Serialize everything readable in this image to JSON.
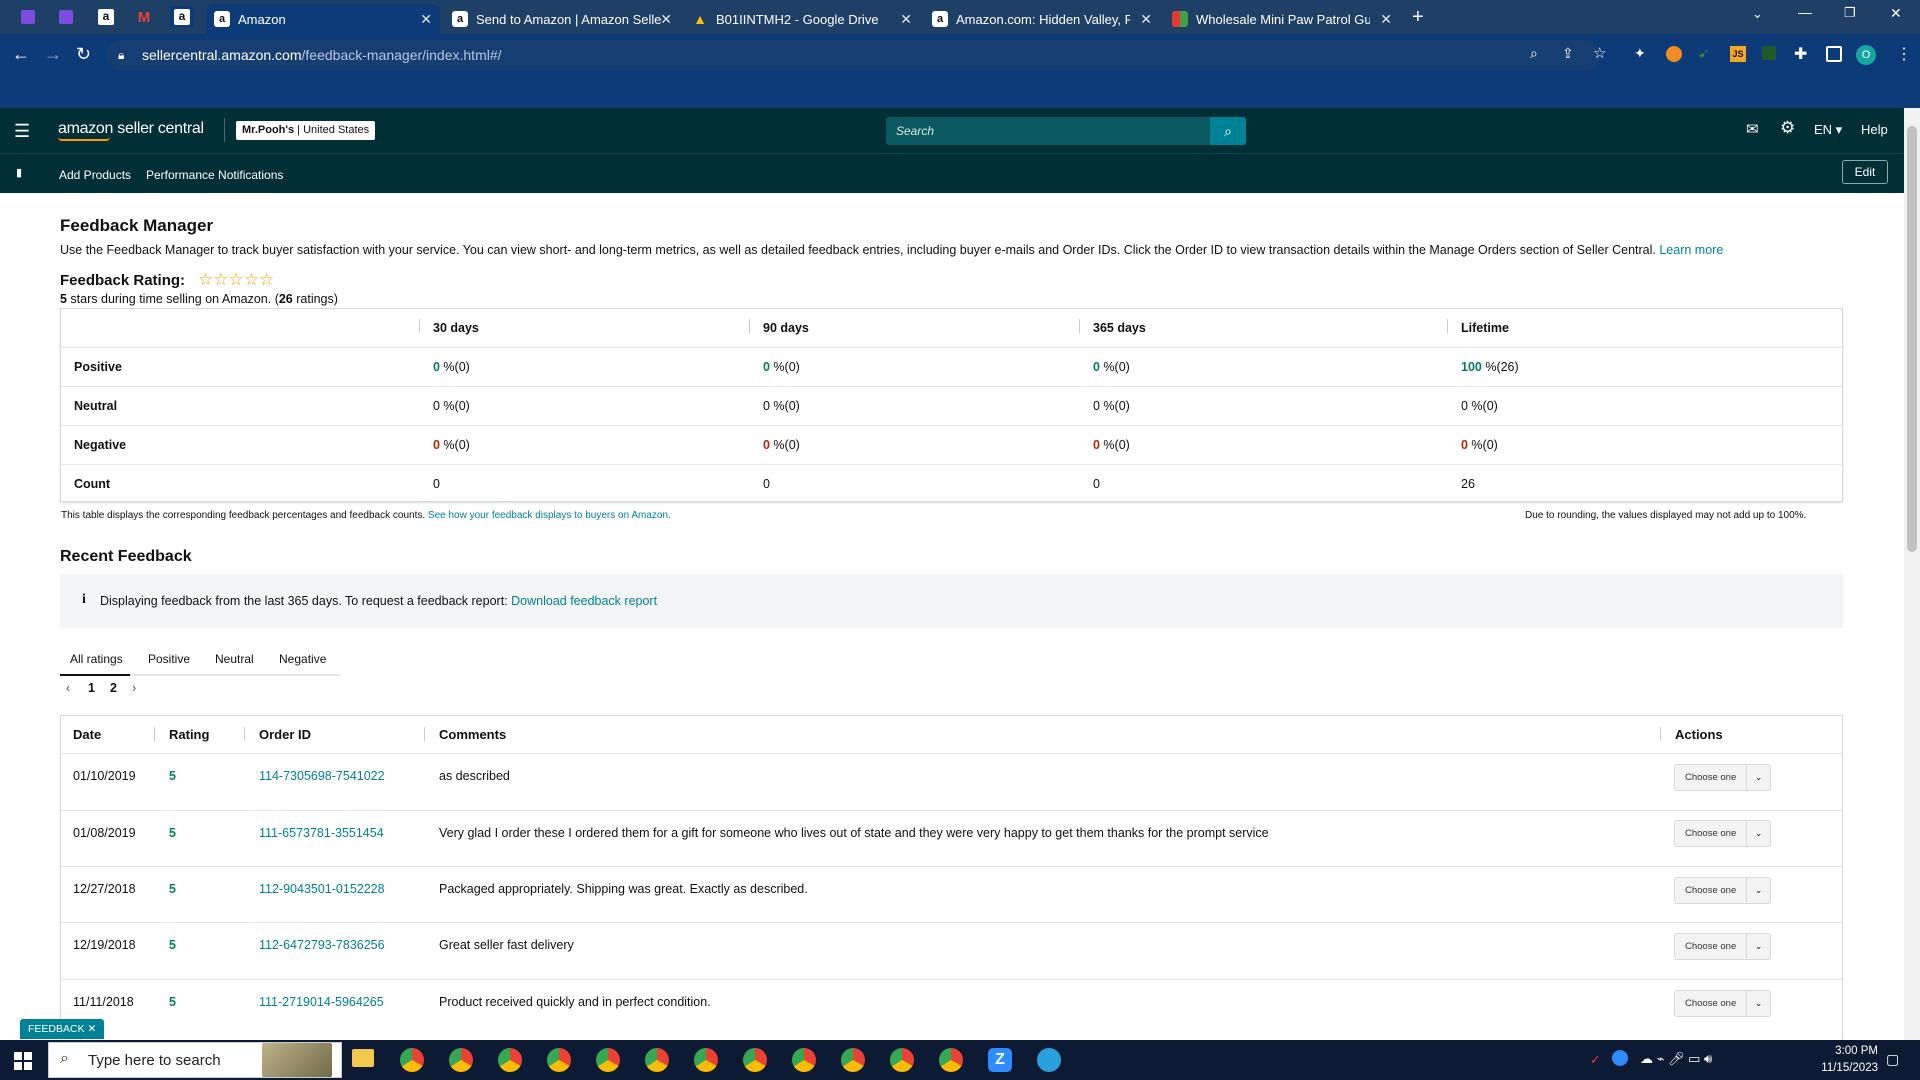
{
  "browser": {
    "tabs": [
      {
        "title": "Amazon",
        "favicon": "amazon-icon"
      },
      {
        "title": "Send to Amazon | Amazon Selle",
        "favicon": "amazon-icon"
      },
      {
        "title": "B01IINTMH2 - Google Drive",
        "favicon": "drive-icon"
      },
      {
        "title": "Amazon.com: Hidden Valley, Ra",
        "favicon": "amazon-icon"
      },
      {
        "title": "Wholesale Mini Paw Patrol Guita",
        "favicon": "tile-icon"
      }
    ],
    "new_tab": "+",
    "url_host": "sellercentral.amazon.com",
    "url_path": "/feedback-manager/index.html#/",
    "profile_initial": "O"
  },
  "header": {
    "logo_text": "amazon seller central",
    "store_name": "Mr.Pooh's",
    "store_region": "United States",
    "search_placeholder": "Search",
    "language": "EN",
    "help": "Help",
    "nav": [
      "Add Products",
      "Performance Notifications"
    ],
    "edit": "Edit"
  },
  "page": {
    "title": "Feedback Manager",
    "description": "Use the Feedback Manager to track buyer satisfaction with your service. You can view short- and long-term metrics, as well as detailed feedback entries, including buyer e-mails and Order IDs. Click the Order ID to view transaction details within the Manage Orders section of Seller Central.",
    "learn_more": "Learn more",
    "rating_label": "Feedback Rating:",
    "stars": 5,
    "rating_sub_pre": "5",
    "rating_sub_mid": " stars during time selling on Amazon. (",
    "rating_count": "26",
    "rating_sub_post": " ratings)"
  },
  "metrics": {
    "columns": [
      "30 days",
      "90 days",
      "365 days",
      "Lifetime"
    ],
    "rows": [
      {
        "label": "Positive",
        "values": [
          {
            "num": "0",
            "rest": " %(0)"
          },
          {
            "num": "0",
            "rest": " %(0)"
          },
          {
            "num": "0",
            "rest": " %(0)"
          },
          {
            "num": "100",
            "rest": " %(26)"
          }
        ]
      },
      {
        "label": "Neutral",
        "values": [
          {
            "num": "0",
            "rest": " %(0)"
          },
          {
            "num": "0",
            "rest": " %(0)"
          },
          {
            "num": "0",
            "rest": " %(0)"
          },
          {
            "num": "0",
            "rest": " %(0)"
          }
        ]
      },
      {
        "label": "Negative",
        "values": [
          {
            "num": "0",
            "rest": " %(0)"
          },
          {
            "num": "0",
            "rest": " %(0)"
          },
          {
            "num": "0",
            "rest": " %(0)"
          },
          {
            "num": "0",
            "rest": " %(0)"
          }
        ]
      },
      {
        "label": "Count",
        "values": [
          {
            "num": "0",
            "rest": ""
          },
          {
            "num": "0",
            "rest": ""
          },
          {
            "num": "0",
            "rest": ""
          },
          {
            "num": "26",
            "rest": ""
          }
        ]
      }
    ],
    "note_left": "This table displays the corresponding feedback percentages and feedback counts.",
    "note_link": "See how your feedback displays to buyers on Amazon.",
    "note_right": "Due to rounding, the values displayed may not add up to 100%."
  },
  "recent": {
    "title": "Recent Feedback",
    "info_text": "Displaying feedback from the last 365 days. To request a feedback report:",
    "info_link": "Download feedback report",
    "filter_tabs": [
      "All ratings",
      "Positive",
      "Neutral",
      "Negative"
    ],
    "pages": [
      "1",
      "2"
    ],
    "columns": [
      "Date",
      "Rating",
      "Order ID",
      "Comments",
      "Actions"
    ],
    "action_label": "Choose one",
    "rows": [
      {
        "date": "01/10/2019",
        "rating": "5",
        "order": "114-7305698-7541022",
        "comment": "as described"
      },
      {
        "date": "01/08/2019",
        "rating": "5",
        "order": "111-6573781-3551454",
        "comment": "Very glad I order these I ordered them for a gift for someone who lives out of state and they were very happy to get them thanks for the prompt service"
      },
      {
        "date": "12/27/2018",
        "rating": "5",
        "order": "112-9043501-0152228",
        "comment": "Packaged appropriately. Shipping was great. Exactly as described."
      },
      {
        "date": "12/19/2018",
        "rating": "5",
        "order": "112-6472793-7836256",
        "comment": "Great seller fast delivery"
      },
      {
        "date": "11/11/2018",
        "rating": "5",
        "order": "111-2719014-5964265",
        "comment": "Product received quickly and in perfect condition."
      }
    ]
  },
  "feedback_tag": "FEEDBACK",
  "taskbar": {
    "search_placeholder": "Type here to search",
    "time": "3:00 PM",
    "date": "11/15/2023"
  }
}
